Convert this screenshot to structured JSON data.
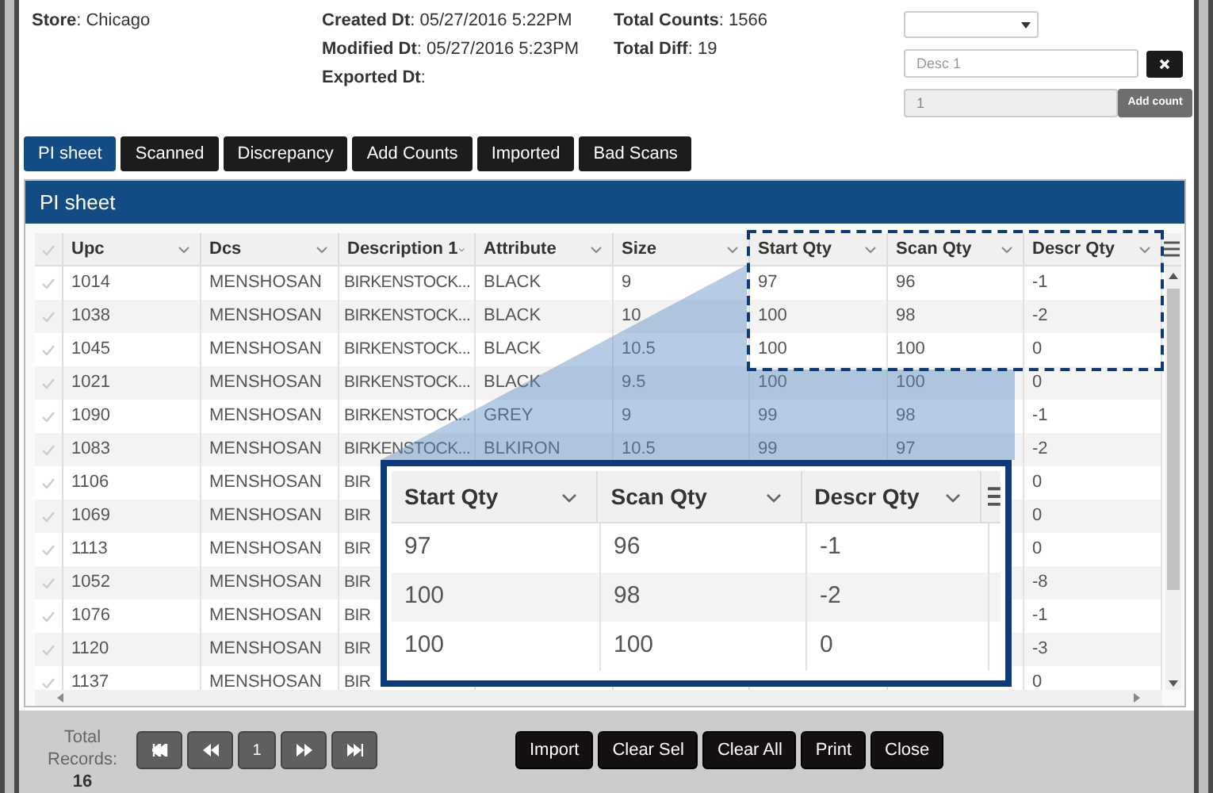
{
  "info_columns": [
    [
      "**Store**: Chicago"
    ],
    [
      "**Created Dt**: 05/27/2016 5:22PM",
      "**Modified Dt**: 05/27/2016 5:23PM",
      "**Exported Dt**:"
    ],
    [
      "**Total Counts**: 1566",
      "**Total Diff**: 19"
    ]
  ],
  "desc_field": {
    "placeholder": "Desc 1"
  },
  "count_field": {
    "value": "1",
    "disabled": true
  },
  "add_button": "Add count",
  "tabs": [
    {
      "label": "PI sheet",
      "selected": true
    },
    {
      "label": "Scanned",
      "selected": false
    },
    {
      "label": "Discrepancy",
      "selected": false
    },
    {
      "label": "Add Counts",
      "selected": false
    },
    {
      "label": "Imported",
      "selected": false
    },
    {
      "label": "Bad Scans",
      "selected": false
    }
  ],
  "panel_title": "PI sheet",
  "grid": {
    "columns": [
      "Upc",
      "Dcs",
      "Description 1",
      "Attribute",
      "Size",
      "Start Qty",
      "Scan Qty",
      "Descr Qty"
    ],
    "rows": [
      {
        "selected": false,
        "cells": [
          "1014",
          "MENSHOSAN",
          "BIRKENSTOCK...",
          "BLACK",
          "9",
          "97",
          "96",
          "-1"
        ]
      },
      {
        "selected": false,
        "cells": [
          "1038",
          "MENSHOSAN",
          "BIRKENSTOCK...",
          "BLACK",
          "10",
          "100",
          "98",
          "-2"
        ]
      },
      {
        "selected": false,
        "cells": [
          "1045",
          "MENSHOSAN",
          "BIRKENSTOCK...",
          "BLACK",
          "10.5",
          "100",
          "100",
          "0"
        ]
      },
      {
        "selected": false,
        "cells": [
          "1021",
          "MENSHOSAN",
          "BIRKENSTOCK...",
          "BLACK",
          "9.5",
          "100",
          "100",
          "0"
        ]
      },
      {
        "selected": false,
        "cells": [
          "1090",
          "MENSHOSAN",
          "BIRKENSTOCK...",
          "GREY",
          "9",
          "99",
          "98",
          "-1"
        ]
      },
      {
        "selected": false,
        "cells": [
          "1083",
          "MENSHOSAN",
          "BIRKENSTOCK...",
          "BLKIRON",
          "10.5",
          "99",
          "97",
          "-2"
        ]
      },
      {
        "selected": false,
        "cells": [
          "1106",
          "MENSHOSAN",
          "BIR",
          null,
          null,
          null,
          null,
          "0"
        ]
      },
      {
        "selected": false,
        "cells": [
          "1069",
          "MENSHOSAN",
          "BIR",
          null,
          null,
          null,
          null,
          "0"
        ]
      },
      {
        "selected": false,
        "cells": [
          "1113",
          "MENSHOSAN",
          "BIR",
          null,
          null,
          null,
          null,
          "0"
        ]
      },
      {
        "selected": false,
        "cells": [
          "1052",
          "MENSHOSAN",
          "BIR",
          null,
          null,
          null,
          null,
          "-8"
        ]
      },
      {
        "selected": false,
        "cells": [
          "1076",
          "MENSHOSAN",
          "BIR",
          null,
          null,
          null,
          null,
          "-1"
        ]
      },
      {
        "selected": false,
        "cells": [
          "1120",
          "MENSHOSAN",
          "BIR",
          null,
          null,
          null,
          null,
          "-3"
        ]
      },
      {
        "selected": false,
        "cells": [
          "1137",
          "MENSHOSAN",
          "BIR",
          null,
          null,
          null,
          null,
          "0"
        ]
      }
    ]
  },
  "callout": {
    "columns": [
      "Start Qty",
      "Scan Qty",
      "Descr Qty"
    ],
    "rows": [
      [
        "97",
        "96",
        "-1"
      ],
      [
        "100",
        "98",
        "-2"
      ],
      [
        "100",
        "100",
        "0"
      ]
    ]
  },
  "footer": {
    "total_label": "Total Records:",
    "total": "16",
    "page": "1",
    "buttons": [
      "Import",
      "Clear Sel",
      "Clear All",
      "Print",
      "Close"
    ]
  }
}
